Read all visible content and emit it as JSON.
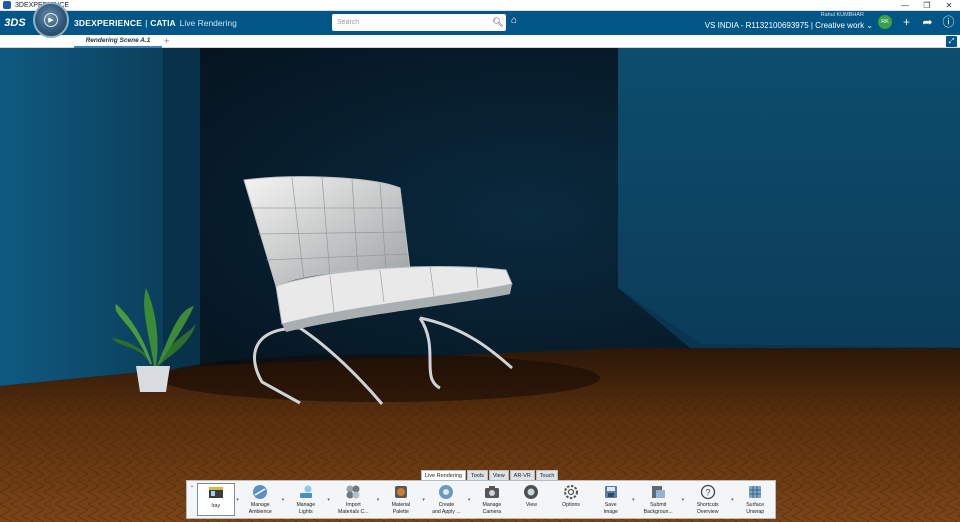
{
  "window": {
    "title": "3DEXPERIENCE",
    "controls": [
      "—",
      "❐",
      "✕"
    ]
  },
  "appbar": {
    "brand_main": "3DEXPERIENCE",
    "brand_sep": "|",
    "brand_app": "CATIA",
    "brand_module": "Live Rendering",
    "search_placeholder": "Search",
    "user_name": "Rahul KUMBHAR",
    "context": "VS INDIA - R1132100693975 | Creative work ⌄",
    "avatar_initials": "RK"
  },
  "tabs": {
    "active_label": "Rendering Scene A.1",
    "add_label": "+"
  },
  "actionbar": {
    "tabs": [
      {
        "label": "Live Rendering",
        "active": true
      },
      {
        "label": "Tools",
        "active": false
      },
      {
        "label": "View",
        "active": false
      },
      {
        "label": "AR-VR",
        "active": false
      },
      {
        "label": "Touch",
        "active": false
      }
    ],
    "commands": [
      {
        "label": "Iray",
        "icon": "iray-icon"
      },
      {
        "label": "Manage\nAmbience",
        "icon": "ambience-icon"
      },
      {
        "label": "Manage\nLights",
        "icon": "lights-icon"
      },
      {
        "label": "Import\nMaterials C...",
        "icon": "import-materials-icon"
      },
      {
        "label": "Material\nPalette",
        "icon": "material-palette-icon"
      },
      {
        "label": "Create\nand Apply ...",
        "icon": "create-apply-icon"
      },
      {
        "label": "Manage\nCamera",
        "icon": "camera-icon"
      },
      {
        "label": "View",
        "icon": "view-icon"
      },
      {
        "label": "Options",
        "icon": "options-gear-icon"
      },
      {
        "label": "Save\nImage",
        "icon": "save-image-icon"
      },
      {
        "label": "Submit\nBackgroun...",
        "icon": "submit-background-icon"
      },
      {
        "label": "Shortcuts\nOverview",
        "icon": "shortcuts-help-icon"
      },
      {
        "label": "Surface\nUnwrap",
        "icon": "surface-unwrap-icon"
      }
    ]
  },
  "colors": {
    "appbar": "#005686",
    "wall": "#0d4a6a",
    "floor": "#6b3a12",
    "accent": "#3d7fb0"
  }
}
